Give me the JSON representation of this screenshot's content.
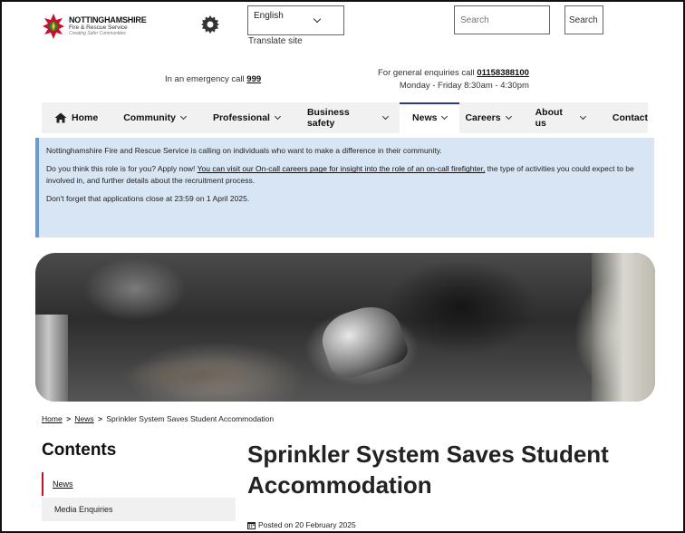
{
  "logo": {
    "line1": "NOTTINGHAMSHIRE",
    "line2": "Fire & Rescue Service",
    "line3": "Creating Safer Communities"
  },
  "language": {
    "selected": "English",
    "translate_label": "Translate site"
  },
  "search": {
    "placeholder": "Search",
    "button_label": "Search"
  },
  "emergency": {
    "prefix": "In an emergency call ",
    "number": "999"
  },
  "enquiries": {
    "prefix": "For general enquiries call ",
    "number": "01158388100",
    "hours": "Monday - Friday 8:30am - 4:30pm"
  },
  "nav": {
    "items": [
      {
        "label": "Home",
        "icon": "home-icon",
        "dropdown": false
      },
      {
        "label": "Community",
        "dropdown": true
      },
      {
        "label": "Professional",
        "dropdown": true
      },
      {
        "label": "Business safety",
        "dropdown": true
      },
      {
        "label": "News",
        "dropdown": true,
        "active": true
      },
      {
        "label": "Careers",
        "dropdown": true
      },
      {
        "label": "About us",
        "dropdown": true
      },
      {
        "label": "Contact",
        "dropdown": false
      }
    ]
  },
  "alert": {
    "p1": "Nottinghamshire Fire and Rescue Service is calling on individuals who want to make a difference in their community.",
    "p2_before": "Do you think this role is for you? Apply now! ",
    "p2_link": "You can visit our On-call careers page for insight into the role of an on-call firefighter,",
    "p2_after": " the type of activities you could expect to be involved in, and further details about the recruitment process.",
    "p3": "Don't forget that applications close at 23:59 on 1 April 2025."
  },
  "breadcrumb": {
    "home": "Home",
    "news": "News",
    "current": "Sprinkler System Saves Student Accommodation",
    "separator": ">"
  },
  "sidebar": {
    "title": "Contents",
    "items": [
      {
        "label": "News"
      },
      {
        "label": "Media Enquiries"
      }
    ]
  },
  "article": {
    "title": "Sprinkler System Saves Student Accommodation",
    "posted": "Posted on 20 February 2025"
  },
  "colors": {
    "accent_red": "#c8102e",
    "nav_active": "#2a3a8c",
    "alert_bg": "#d8e5f4"
  }
}
